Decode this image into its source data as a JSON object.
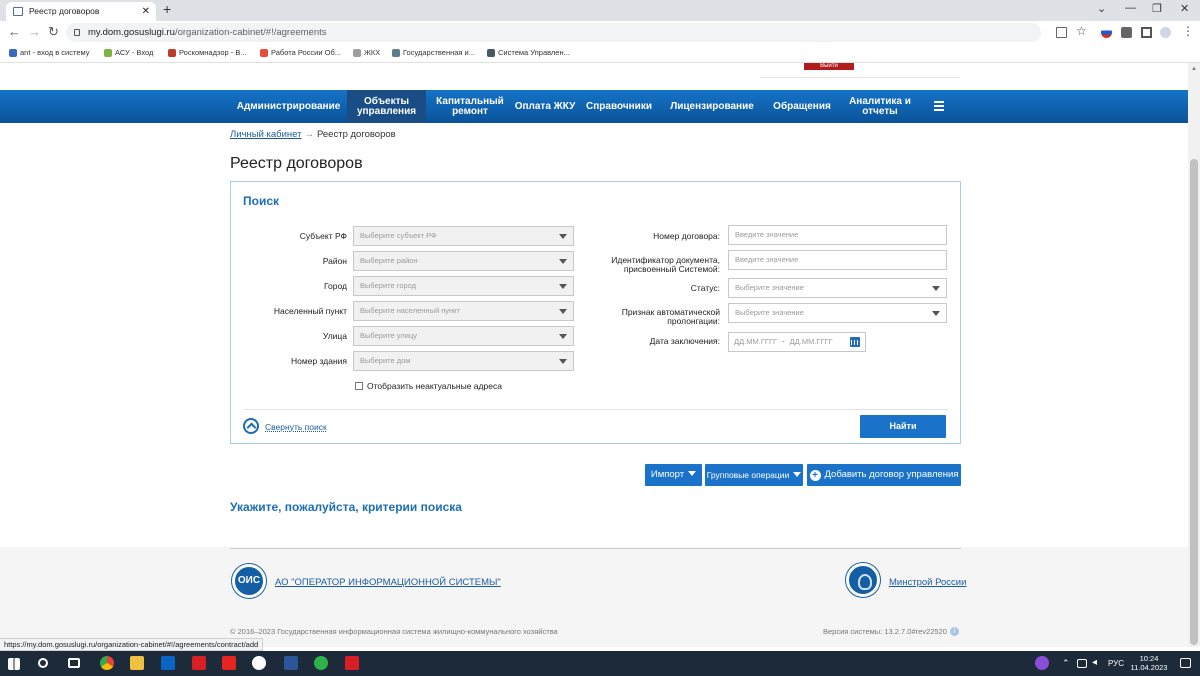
{
  "browser": {
    "tab_title": "Реестр договоров",
    "url_host": "my.dom.gosuslugi.ru",
    "url_path": "/organization-cabinet/#!/agreements",
    "bookmarks": [
      "ant - вход в систему",
      "АСУ - Вход",
      "Роскомнадзор - В...",
      "Работа России Об...",
      "ЖКХ",
      "Государственная и...",
      "Система Управлен..."
    ],
    "status_url": "https://my.dom.gosuslugi.ru/organization-cabinet/#!/agreements/contract/add"
  },
  "header": {
    "exit_label": "Выйти"
  },
  "nav": {
    "items": [
      {
        "label": "Администрирование"
      },
      {
        "label": "Объекты управления"
      },
      {
        "label": "Капитальный ремонт"
      },
      {
        "label": "Оплата ЖКУ"
      },
      {
        "label": "Справочники"
      },
      {
        "label": "Лицензирование"
      },
      {
        "label": "Обращения"
      },
      {
        "label": "Аналитика и отчеты"
      }
    ]
  },
  "breadcrumb": {
    "home": "Личный кабинет",
    "arrow": "→",
    "current": "Реестр договоров"
  },
  "page_title": "Реестр договоров",
  "search": {
    "title": "Поиск",
    "left_fields": [
      {
        "label": "Субъект РФ",
        "placeholder": "Выберите субъект РФ"
      },
      {
        "label": "Район",
        "placeholder": "Выберите район"
      },
      {
        "label": "Город",
        "placeholder": "Выберите город"
      },
      {
        "label": "Населенный пункт",
        "placeholder": "Выберите населенный пункт"
      },
      {
        "label": "Улица",
        "placeholder": "Выберите улицу"
      },
      {
        "label": "Номер здания",
        "placeholder": "Выберите дом"
      }
    ],
    "right_fields": {
      "contract_number": {
        "label": "Номер договора:",
        "placeholder": "Введите значение"
      },
      "doc_id": {
        "label": "Идентификатор документа, присвоенный Системой:",
        "placeholder": "Введите значение"
      },
      "status": {
        "label": "Статус:",
        "placeholder": "Выберите значение"
      },
      "prolongation": {
        "label": "Признак автоматической пролонгации:",
        "placeholder": "Выберите значение"
      },
      "date": {
        "label": "Дата заключения:",
        "from": "ДД.ММ.ГГГГ",
        "dash": "-",
        "to": "ДД.ММ.ГГГГ"
      }
    },
    "checkbox_label": "Отобразить неактуальные адреса",
    "collapse_label": "Свернуть поиск",
    "find_button": "Найти"
  },
  "actions": {
    "import": "Импорт",
    "group_ops": "Групповые операции",
    "add": "Добавить договор управления",
    "add_icon": "+"
  },
  "hint": "Укажите, пожалуйста, критерии поиска",
  "footer": {
    "ois_logo": "ОИС",
    "ois_link": "АО \"ОПЕРАТОР ИНФОРМАЦИОННОЙ СИСТЕМЫ\"",
    "ministry_link": "Минстрой России",
    "copyright": "© 2016–2023 Государственная информационная система жилищно-коммунального хозяйства",
    "version": "Версия системы: 13.2.7.0#rev22520",
    "info_icon": "i"
  },
  "taskbar": {
    "lang": "РУС",
    "time": "10:24",
    "date": "11.04.2023"
  },
  "colors": {
    "nav_blue": "#0d5aa7",
    "accent": "#1a73c8",
    "title_blue": "#1d6eb5",
    "exit_red": "#b11c1c"
  }
}
